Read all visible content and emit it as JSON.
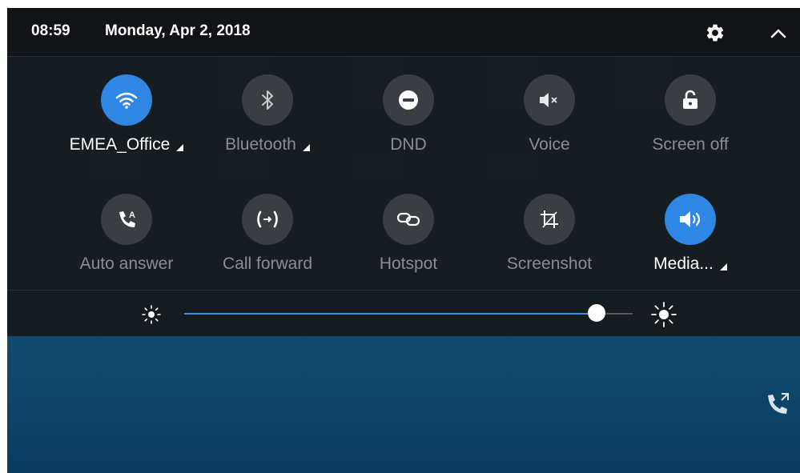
{
  "status_bar": {
    "time": "08:59",
    "date": "Monday, Apr 2, 2018"
  },
  "icons": {
    "settings": "gear-icon",
    "collapse": "chevron-up-icon"
  },
  "quick_settings": [
    {
      "label": "EMEA_Office",
      "icon": "wifi-icon",
      "active": true,
      "has_menu": true
    },
    {
      "label": "Bluetooth",
      "icon": "bluetooth-icon",
      "active": false,
      "has_menu": true
    },
    {
      "label": "DND",
      "icon": "do-not-disturb-icon",
      "active": false,
      "has_menu": false
    },
    {
      "label": "Voice",
      "icon": "mute-icon",
      "active": false,
      "has_menu": false
    },
    {
      "label": "Screen off",
      "icon": "lock-icon",
      "active": false,
      "has_menu": false
    },
    {
      "label": "Auto answer",
      "icon": "auto-answer-icon",
      "active": false,
      "has_menu": false
    },
    {
      "label": "Call forward",
      "icon": "call-forward-icon",
      "active": false,
      "has_menu": false
    },
    {
      "label": "Hotspot",
      "icon": "hotspot-icon",
      "active": false,
      "has_menu": false
    },
    {
      "label": "Screenshot",
      "icon": "screenshot-icon",
      "active": false,
      "has_menu": false
    },
    {
      "label": "Media...",
      "icon": "speaker-icon",
      "active": true,
      "has_menu": true
    }
  ],
  "brightness": {
    "level": 0.92
  },
  "colors": {
    "accent": "#2f86e4",
    "shade": "#16181b",
    "inactive_circle": "#3a3d42",
    "inactive_text": "#8a8d92"
  }
}
